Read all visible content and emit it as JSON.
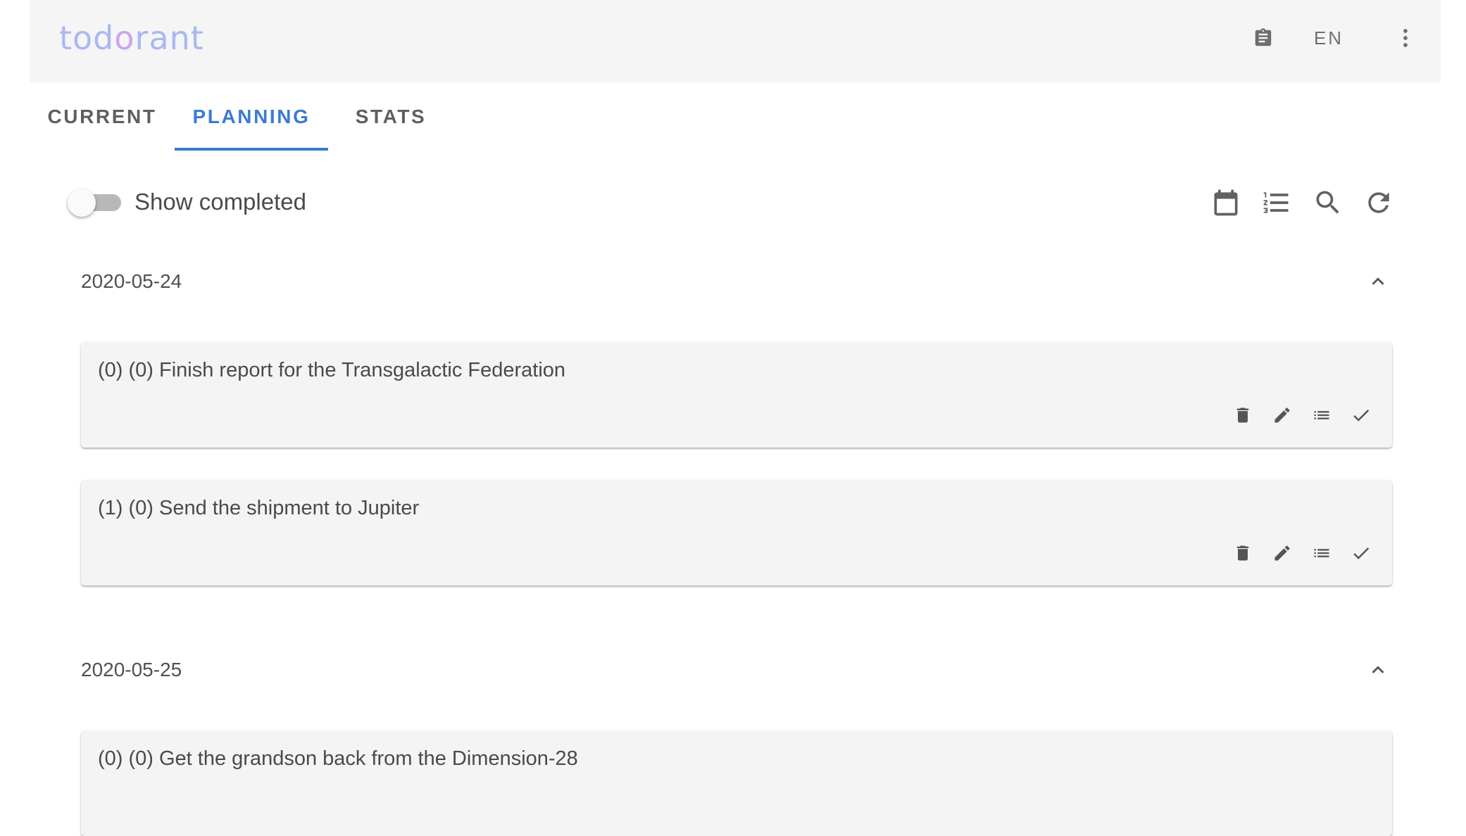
{
  "app": {
    "logo_text_a": "tod",
    "logo_text_b": "o",
    "logo_text_c": "rant",
    "language": "EN",
    "clipboard_icon": "clipboard-icon",
    "more_icon": "more-vert-icon"
  },
  "tabs": [
    {
      "label": "CURRENT",
      "active": false
    },
    {
      "label": "PLANNING",
      "active": true
    },
    {
      "label": "STATS",
      "active": false
    }
  ],
  "toolbar": {
    "show_completed_label": "Show completed",
    "show_completed": false,
    "icons": [
      "calendar-icon",
      "numbered-list-icon",
      "search-icon",
      "refresh-icon"
    ]
  },
  "groups": [
    {
      "date": "2020-05-24",
      "expanded": true,
      "todos": [
        {
          "text": "(0) (0) Finish report for the Transgalactic Federation"
        },
        {
          "text": "(1) (0) Send the shipment to Jupiter"
        }
      ]
    },
    {
      "date": "2020-05-25",
      "expanded": true,
      "todos": [
        {
          "text": "(0) (0) Get the grandson back from the Dimension-28"
        }
      ]
    }
  ],
  "colors": {
    "accent": "#3a7bd5",
    "appbar_bg": "#f5f5f5",
    "card_bg": "#f4f4f4",
    "logo_blue": "#a9b8f2",
    "logo_purple": "#c7a6ee"
  }
}
